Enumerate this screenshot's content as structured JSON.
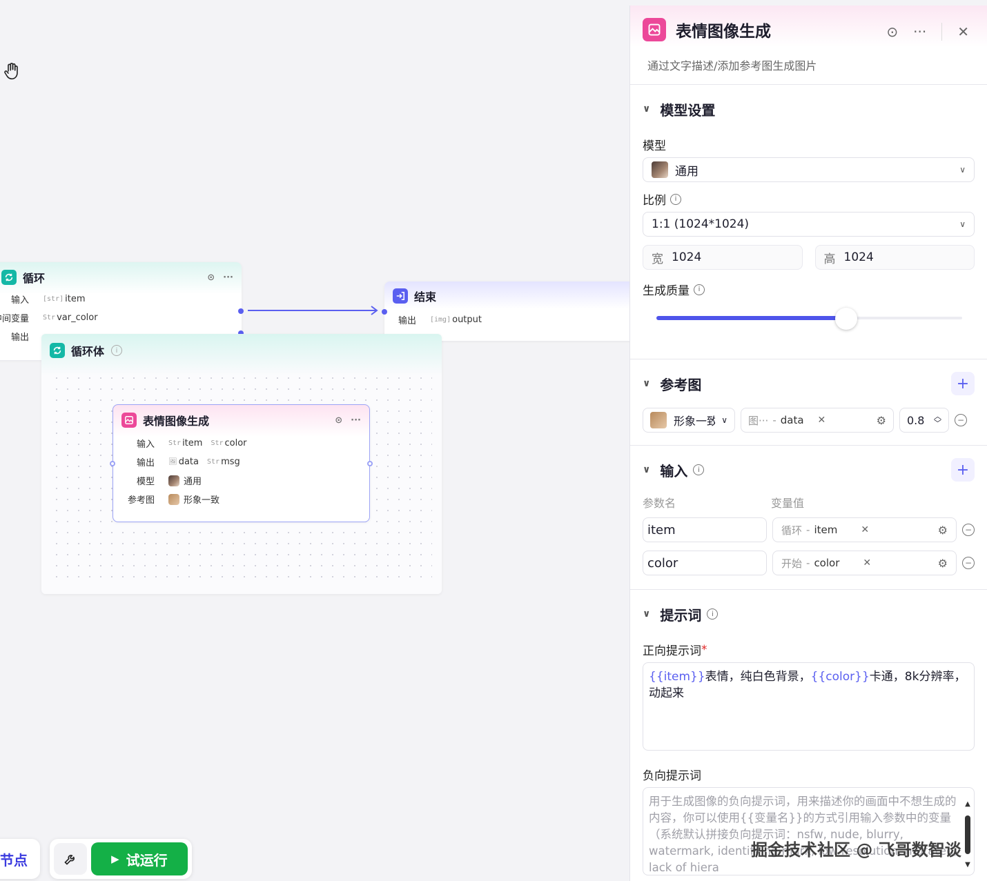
{
  "canvas": {
    "loop_node": {
      "title": "循环",
      "rows": [
        {
          "label": "输入",
          "tags": [
            {
              "type": "[str]",
              "name": "item"
            }
          ]
        },
        {
          "label": "中间变量",
          "tags": [
            {
              "type": "Str",
              "name": "var_color"
            }
          ]
        },
        {
          "label": "输出",
          "tags": []
        }
      ]
    },
    "end_node": {
      "title": "结束",
      "rows": [
        {
          "label": "输出",
          "tags": [
            {
              "type": "[img]",
              "name": "output"
            }
          ]
        }
      ]
    },
    "loop_body": {
      "title": "循环体"
    },
    "image_node": {
      "title": "表情图像生成",
      "rows": [
        {
          "label": "输入",
          "tags": [
            {
              "type": "Str",
              "name": "item"
            },
            {
              "type": "Str",
              "name": "color"
            }
          ]
        },
        {
          "label": "输出",
          "tags": [
            {
              "type": "img",
              "name": "data"
            },
            {
              "type": "Str",
              "name": "msg"
            }
          ]
        },
        {
          "label": "模型",
          "tags": [
            {
              "type": "avatar",
              "name": "通用"
            }
          ]
        },
        {
          "label": "参考图",
          "tags": [
            {
              "type": "avatar",
              "name": "形象一致"
            }
          ]
        }
      ]
    }
  },
  "toolbar": {
    "left_label": "节点",
    "run_label": "试运行"
  },
  "panel": {
    "title": "表情图像生成",
    "description": "通过文字描述/添加参考图生成图片",
    "model_section": {
      "title": "模型设置",
      "model_label": "模型",
      "model_value": "通用",
      "ratio_label": "比例",
      "ratio_value": "1:1 (1024*1024)",
      "width_label": "宽",
      "width_value": "1024",
      "height_label": "高",
      "height_value": "1024",
      "quality_label": "生成质量",
      "quality_fraction": 0.62
    },
    "ref_section": {
      "title": "参考图",
      "ref_type": "形象一致",
      "ref_src": "图···",
      "ref_var": "data",
      "ref_weight": "0.8"
    },
    "input_section": {
      "title": "输入",
      "col_name": "参数名",
      "col_value": "变量值",
      "rows": [
        {
          "name": "item",
          "src": "循环",
          "var": "item"
        },
        {
          "name": "color",
          "src": "开始",
          "var": "color"
        }
      ]
    },
    "prompt_section": {
      "title": "提示词",
      "positive_label": "正向提示词",
      "required_mark": "*",
      "positive_parts": [
        {
          "text": "{{item}}",
          "var": true
        },
        {
          "text": "表情，纯白色背景，",
          "var": false
        },
        {
          "text": "{{color}}",
          "var": true
        },
        {
          "text": "卡通，8k分辨率，动起来",
          "var": false
        }
      ],
      "negative_label": "负向提示词",
      "negative_placeholder": "用于生成图像的负向提示词，用来描述你的画面中不想生成的内容，你可以使用{{变量名}}的方式引用输入参数中的变量（系统默认拼接负向提示词：nsfw, nude, blurry, watermark, identifying mark, low resolution, mutated, lack of hiera"
    }
  },
  "watermark": "掘金技术社区 @ 飞哥数智谈",
  "colors": {
    "accent": "#5a5ff0",
    "run_green": "#14b047",
    "image_node_icon": "#ec4899",
    "loop_icon": "#14b8a6",
    "end_icon": "#5a5ff0"
  }
}
